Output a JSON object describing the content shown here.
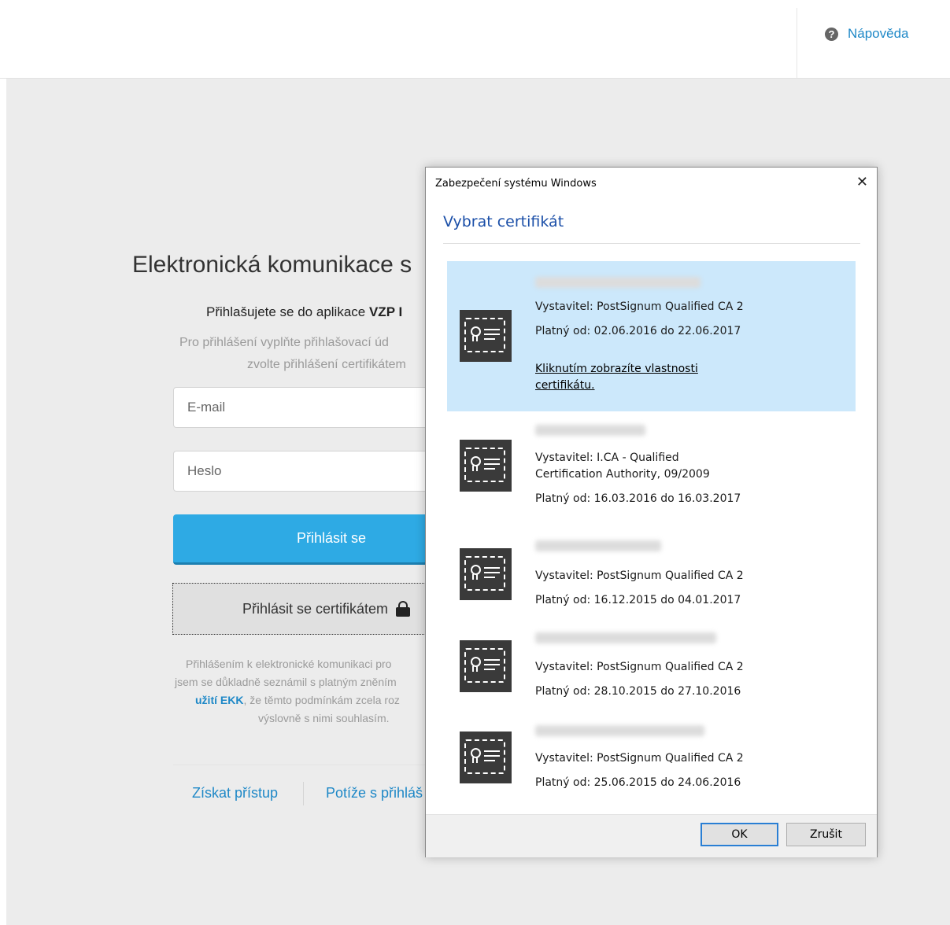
{
  "header": {
    "help_label": "Nápověda",
    "help_icon": "question-circle-icon"
  },
  "login": {
    "title": "Elektronická komunikace s",
    "intro_prefix": "Přihlašujete se do aplikace ",
    "intro_app": "VZP I",
    "intro_line2": "Pro přihlášení vyplňte přihlašovací úd",
    "intro_line3": "zvolte přihlášení certifikátem",
    "email_placeholder": "E-mail",
    "password_placeholder": "Heslo",
    "login_button": "Přihlásit se",
    "cert_button": "Přihlásit se certifikátem",
    "terms": {
      "line1": "Přihlášením k elektronické komunikaci pro",
      "line2": "jsem se důkladně seznámil s platným zněním",
      "line3_link": "užití EKK",
      "line3_rest": ", že těmto podmínkám zcela roz",
      "line4": "výslovně s nimi souhlasím."
    },
    "access_link": "Získat přístup",
    "trouble_link": "Potíže s přihláš"
  },
  "dialog": {
    "window_title": "Zabezpečení systému Windows",
    "heading": "Vybrat certifikát",
    "close_glyph": "✕",
    "certificates": [
      {
        "issuer": "Vystavitel: PostSignum Qualified CA 2",
        "validity": "Platný od: 02.06.2016 do 22.06.2017",
        "link": "Kliknutím zobrazíte vlastnosti certifikátu.",
        "selected": true
      },
      {
        "issuer_line1": "Vystavitel: I.CA - Qualified",
        "issuer_line2": "Certification Authority, 09/2009",
        "validity": "Platný od: 16.03.2016 do 16.03.2017"
      },
      {
        "issuer": "Vystavitel: PostSignum Qualified CA 2",
        "validity": "Platný od: 16.12.2015 do 04.01.2017"
      },
      {
        "issuer": "Vystavitel: PostSignum Qualified CA 2",
        "validity": "Platný od: 28.10.2015 do 27.10.2016"
      },
      {
        "issuer": "Vystavitel: PostSignum Qualified CA 2",
        "validity": "Platný od: 25.06.2015 do 24.06.2016"
      }
    ],
    "ok_label": "OK",
    "cancel_label": "Zrušit"
  },
  "colors": {
    "accent": "#2eaae4",
    "link": "#1e88c7",
    "selection": "#cce8fb",
    "dialog_heading": "#1b4fa8"
  }
}
